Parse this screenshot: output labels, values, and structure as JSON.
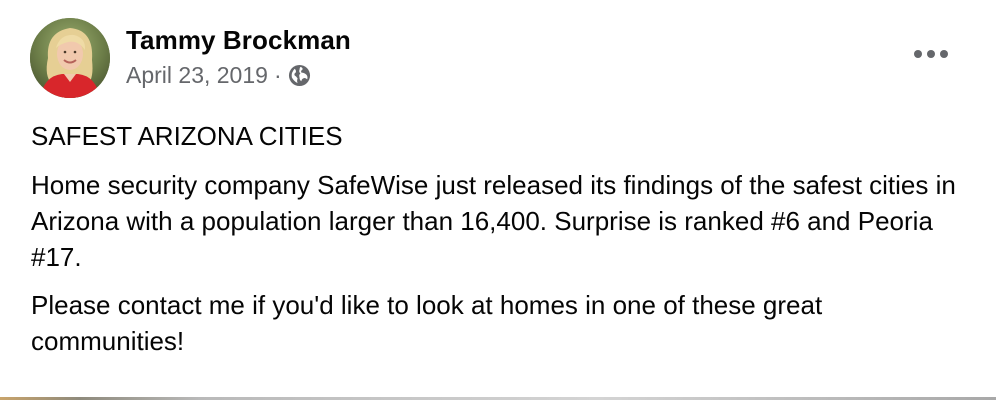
{
  "post": {
    "author_name": "Tammy Brockman",
    "date": "April 23, 2019",
    "separator": "·",
    "privacy_icon": "globe-icon",
    "more_icon": "more-options-icon",
    "paragraphs": [
      "SAFEST ARIZONA CITIES",
      "Home security company SafeWise just released its findings of the safest cities in Arizona with a population larger than 16,400. Surprise is ranked #6 and Peoria #17.",
      "Please contact me if you'd like to look at homes in one of these great communities!"
    ]
  },
  "colors": {
    "text": "#050505",
    "secondary_text": "#65676b",
    "background": "#ffffff"
  }
}
